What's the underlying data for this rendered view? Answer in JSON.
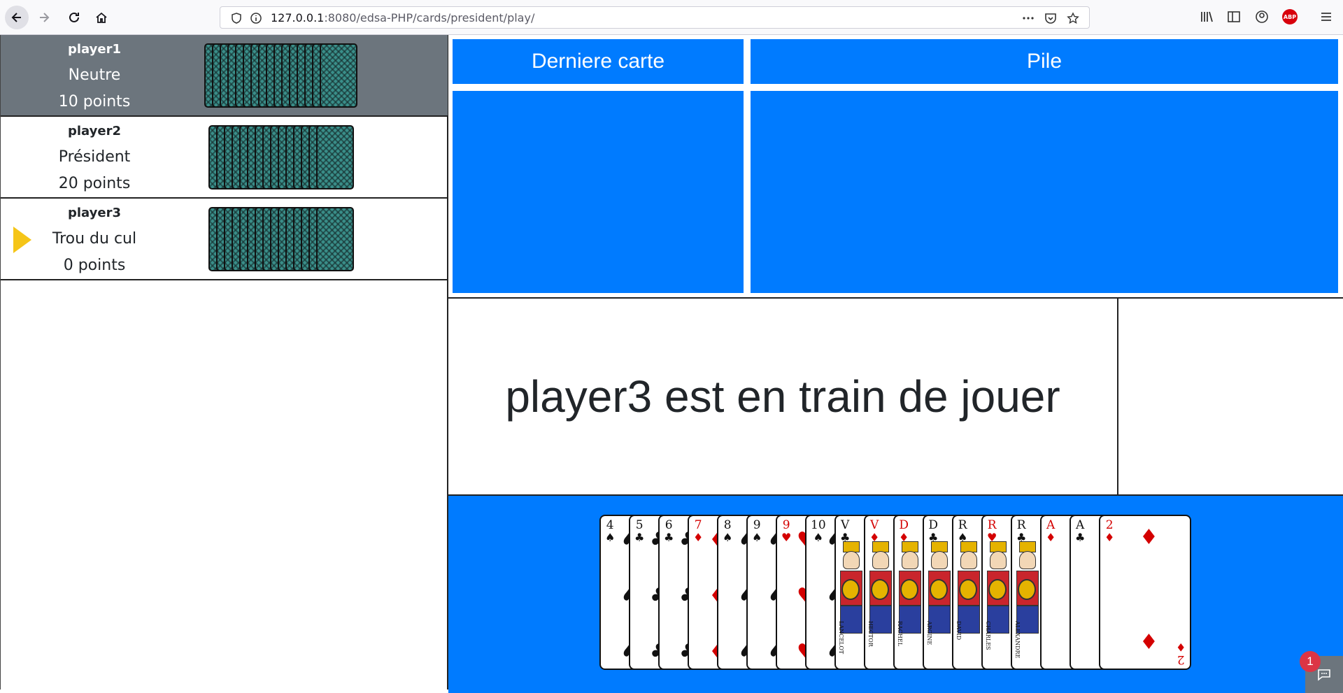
{
  "browser": {
    "url_host": "127.0.0.1",
    "url_rest": ":8080/edsa-PHP/cards/president/play/"
  },
  "players": [
    {
      "name": "player1",
      "role": "Neutre",
      "points": "10 points",
      "active": true,
      "turn": false,
      "cards": 16
    },
    {
      "name": "player2",
      "role": "Président",
      "points": "20 points",
      "active": false,
      "turn": false,
      "cards": 15
    },
    {
      "name": "player3",
      "role": "Trou du cul",
      "points": "0 points",
      "active": false,
      "turn": true,
      "cards": 15
    }
  ],
  "panels": {
    "last_card_title": "Derniere carte",
    "pile_title": "Pile"
  },
  "status_text": "player3 est en train de jouer",
  "hand": [
    {
      "rank": "4",
      "suit": "♠",
      "color": "black"
    },
    {
      "rank": "5",
      "suit": "♣",
      "color": "black"
    },
    {
      "rank": "6",
      "suit": "♣",
      "color": "black"
    },
    {
      "rank": "7",
      "suit": "♦",
      "color": "red"
    },
    {
      "rank": "8",
      "suit": "♠",
      "color": "black"
    },
    {
      "rank": "9",
      "suit": "♠",
      "color": "black"
    },
    {
      "rank": "9",
      "suit": "♥",
      "color": "red"
    },
    {
      "rank": "10",
      "suit": "♠",
      "color": "black"
    },
    {
      "rank": "V",
      "suit": "♣",
      "color": "black",
      "face": "LANCELOT"
    },
    {
      "rank": "V",
      "suit": "♦",
      "color": "red",
      "face": "HECTOR"
    },
    {
      "rank": "D",
      "suit": "♦",
      "color": "red",
      "face": "RACHEL"
    },
    {
      "rank": "D",
      "suit": "♣",
      "color": "black",
      "face": "ARGINE"
    },
    {
      "rank": "R",
      "suit": "♠",
      "color": "black",
      "face": "DAVID"
    },
    {
      "rank": "R",
      "suit": "♥",
      "color": "red",
      "face": "CHARLES"
    },
    {
      "rank": "R",
      "suit": "♣",
      "color": "black",
      "face": "ALEXANDRE"
    },
    {
      "rank": "A",
      "suit": "♦",
      "color": "red"
    },
    {
      "rank": "A",
      "suit": "♣",
      "color": "black"
    },
    {
      "rank": "2",
      "suit": "♦",
      "color": "red"
    }
  ],
  "chat": {
    "badge_count": "1"
  },
  "icons": {
    "back": "arrow-left-icon",
    "forward": "arrow-right-icon",
    "reload": "reload-icon",
    "home": "home-icon",
    "shield": "tracking-shield-icon",
    "info": "info-icon",
    "more": "more-icon",
    "pocket": "pocket-icon",
    "bookmark": "star-icon",
    "library": "library-icon",
    "sidebar": "sidebar-icon",
    "account": "account-icon",
    "menu": "hamburger-menu-icon",
    "adblock": "ABP"
  },
  "colors": {
    "accent": "#007bff",
    "active_row": "#6c757d",
    "turn_marker": "#f5c518",
    "card_back": "#3a8f8a"
  }
}
